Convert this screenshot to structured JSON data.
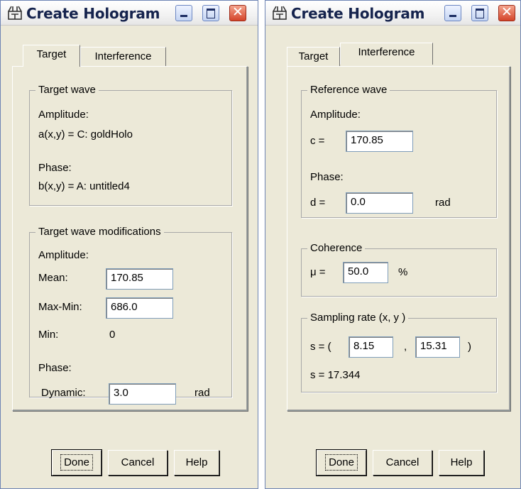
{
  "left_window": {
    "title": "Create Hologram",
    "tabs": [
      {
        "label": "Target",
        "active": true
      },
      {
        "label": "Interference",
        "active": false
      }
    ],
    "target_wave": {
      "legend": "Target wave",
      "amplitude_label": "Amplitude:",
      "amplitude_value": "a(x,y)  =  C: goldHolo",
      "phase_label": "Phase:",
      "phase_value": "b(x,y)  =  A: untitled4"
    },
    "modifications": {
      "legend": "Target wave modifications",
      "amplitude_label": "Amplitude:",
      "mean_label": "Mean:",
      "mean_value": "170.85",
      "maxmin_label": "Max-Min:",
      "maxmin_value": "686.0",
      "min_label": "Min:",
      "min_value": "0",
      "phase_label": "Phase:",
      "dynamic_label": "Dynamic:",
      "dynamic_value": "3.0",
      "dynamic_unit": "rad"
    },
    "buttons": {
      "done": "Done",
      "cancel": "Cancel",
      "help": "Help"
    }
  },
  "right_window": {
    "title": "Create Hologram",
    "tabs": [
      {
        "label": "Target",
        "active": false
      },
      {
        "label": "Interference",
        "active": true
      }
    ],
    "reference_wave": {
      "legend": "Reference wave",
      "amplitude_label": "Amplitude:",
      "c_label": "c =",
      "c_value": "170.85",
      "phase_label": "Phase:",
      "d_label": "d =",
      "d_value": "0.0",
      "d_unit": "rad"
    },
    "coherence": {
      "legend": "Coherence",
      "mu_label": "μ =",
      "mu_value": "50.0",
      "mu_unit": "%"
    },
    "sampling": {
      "legend": "Sampling rate (x, y )",
      "s_open": "s = (",
      "sx_value": "8.15",
      "separator": ",",
      "sy_value": "15.31",
      "s_close": ")",
      "s_result": "s =  17.344"
    },
    "buttons": {
      "done": "Done",
      "cancel": "Cancel",
      "help": "Help"
    }
  },
  "colors": {
    "dialog_bg": "#ece9d8",
    "title_text": "#15234d",
    "close_button": "#d4442a"
  },
  "icons": [
    "hologram-app-icon",
    "minimize-icon",
    "maximize-icon",
    "close-icon"
  ]
}
